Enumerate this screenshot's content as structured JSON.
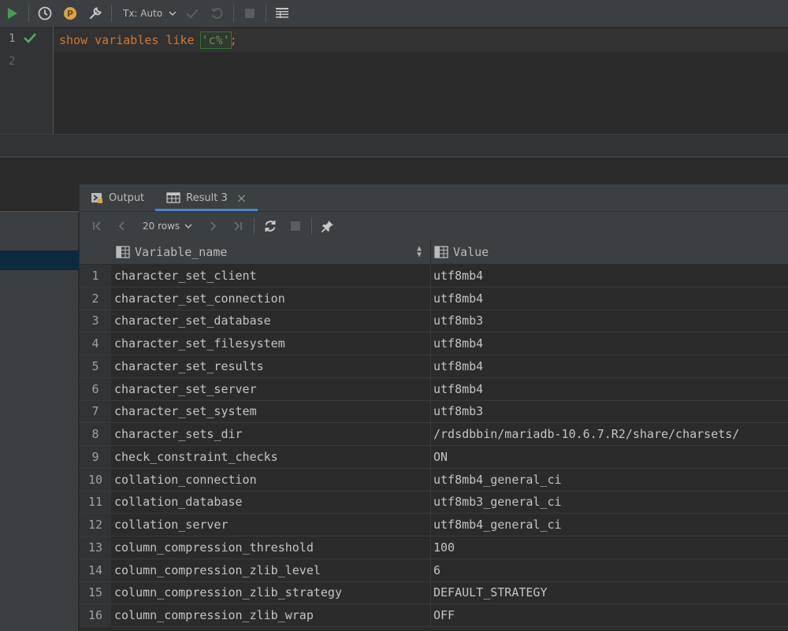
{
  "toolbar": {
    "tx_mode": "Tx: Auto"
  },
  "editor": {
    "line_numbers": [
      "1",
      "2"
    ],
    "code": {
      "keywords": "show variables like ",
      "string": "'c%'",
      "terminator": ";"
    }
  },
  "results": {
    "tabs": [
      {
        "label": "Output"
      },
      {
        "label": "Result 3"
      }
    ],
    "page_size": "20 rows",
    "columns": [
      "Variable_name",
      "Value"
    ],
    "rows": [
      {
        "num": "1",
        "name": "character_set_client",
        "value": "utf8mb4"
      },
      {
        "num": "2",
        "name": "character_set_connection",
        "value": "utf8mb4"
      },
      {
        "num": "3",
        "name": "character_set_database",
        "value": "utf8mb3"
      },
      {
        "num": "4",
        "name": "character_set_filesystem",
        "value": "utf8mb4"
      },
      {
        "num": "5",
        "name": "character_set_results",
        "value": "utf8mb4"
      },
      {
        "num": "6",
        "name": "character_set_server",
        "value": "utf8mb4"
      },
      {
        "num": "7",
        "name": "character_set_system",
        "value": "utf8mb3"
      },
      {
        "num": "8",
        "name": "character_sets_dir",
        "value": "/rdsdbbin/mariadb-10.6.7.R2/share/charsets/"
      },
      {
        "num": "9",
        "name": "check_constraint_checks",
        "value": "ON"
      },
      {
        "num": "10",
        "name": "collation_connection",
        "value": "utf8mb4_general_ci"
      },
      {
        "num": "11",
        "name": "collation_database",
        "value": "utf8mb3_general_ci"
      },
      {
        "num": "12",
        "name": "collation_server",
        "value": "utf8mb4_general_ci"
      },
      {
        "num": "13",
        "name": "column_compression_threshold",
        "value": "100"
      },
      {
        "num": "14",
        "name": "column_compression_zlib_level",
        "value": "6"
      },
      {
        "num": "15",
        "name": "column_compression_zlib_strategy",
        "value": "DEFAULT_STRATEGY"
      },
      {
        "num": "16",
        "name": "column_compression_zlib_wrap",
        "value": "OFF"
      }
    ]
  },
  "colors": {
    "run": "#499c54",
    "check": "#59a869",
    "profile": "#d9a343",
    "accent": "#4a88c7",
    "keyword": "#cc7832",
    "string": "#6a8759"
  },
  "icons": {
    "toolbar": [
      "run-icon",
      "history-icon",
      "profile-icon",
      "settings-wrench-icon",
      "chevron-down-icon",
      "commit-check-icon",
      "rollback-icon",
      "stop-icon",
      "table-view-icon"
    ],
    "results": [
      "first-page-icon",
      "previous-page-icon",
      "next-page-icon",
      "last-page-icon",
      "refresh-icon",
      "stop-icon",
      "pin-icon"
    ]
  }
}
